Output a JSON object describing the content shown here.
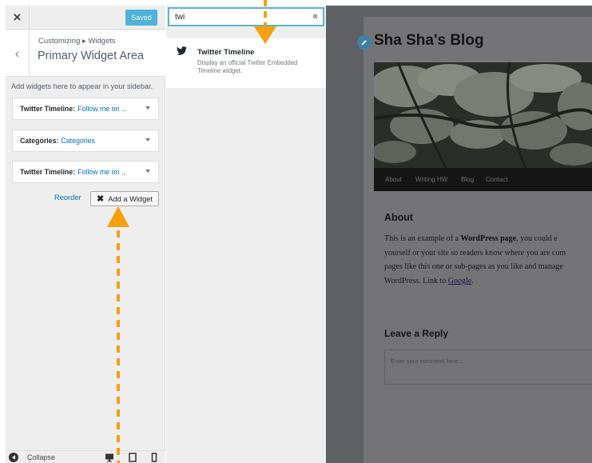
{
  "customizer": {
    "close_label": "×",
    "saved_label": "Saved",
    "back_label": "‹",
    "breadcrumb": "Customizing ▸ Widgets",
    "panel_title": "Primary Widget Area",
    "description": "Add widgets here to appear in your sidebar.",
    "widgets": [
      {
        "name": "Twitter Timeline:",
        "title": "Follow me on ..."
      },
      {
        "name": "Categories:",
        "title": "Categories"
      },
      {
        "name": "Twitter Timeline:",
        "title": "Follow me on ..."
      }
    ],
    "reorder_label": "Reorder",
    "add_widget_label": "Add a Widget",
    "add_widget_icon": "✖",
    "collapse_label": "Collapse"
  },
  "widget_search": {
    "query": "twi",
    "clear_icon": "⊗",
    "result": {
      "name": "Twitter Timeline",
      "description": "Display an official Twitter Embedded Timeline widget."
    }
  },
  "preview": {
    "site_title": "Sha Sha's Blog",
    "nav_items": [
      "About",
      "Writing HW",
      "Blog",
      "Contact"
    ],
    "page_heading": "About",
    "body_lines": [
      "This is an example of a ",
      "WordPress page",
      ", you could e",
      "yourself or your site so readers know where you are com",
      "pages like this one or sub-pages as you like and manage",
      "WordPress. Link to ",
      "Google",
      "."
    ],
    "reply_heading": "Leave a Reply",
    "comment_placeholder": "Enter your comment here..."
  },
  "colors": {
    "accent_blue": "#0073aa",
    "saved_button": "#4fb3d8",
    "search_border": "#58b5d5",
    "tutorial_arrow": "#f5a011",
    "preview_overlay": "#5f6064"
  }
}
